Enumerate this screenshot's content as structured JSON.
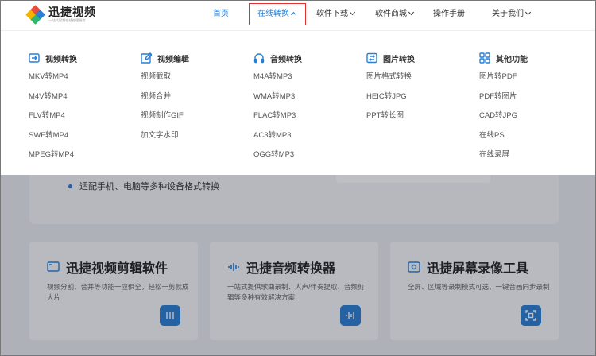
{
  "header": {
    "logo_name": "迅捷视频",
    "logo_slogan": "一站式视频在线处理服务"
  },
  "nav": [
    {
      "label": "首页"
    },
    {
      "label": "在线转换"
    },
    {
      "label": "软件下载"
    },
    {
      "label": "软件商城"
    },
    {
      "label": "操作手册"
    },
    {
      "label": "关于我们"
    }
  ],
  "dropdown": {
    "columns": [
      {
        "title": "视频转换",
        "icon": "video-convert-icon",
        "items": [
          "MKV转MP4",
          "M4V转MP4",
          "FLV转MP4",
          "SWF转MP4",
          "MPEG转MP4"
        ]
      },
      {
        "title": "视频编辑",
        "icon": "edit-icon",
        "items": [
          "视频截取",
          "视频合并",
          "视频制作GIF",
          "加文字水印"
        ]
      },
      {
        "title": "音频转换",
        "icon": "headphones-icon",
        "items": [
          "M4A转MP3",
          "WMA转MP3",
          "FLAC转MP3",
          "AC3转MP3",
          "OGG转MP3"
        ]
      },
      {
        "title": "图片转换",
        "icon": "image-convert-icon",
        "items": [
          "图片格式转换",
          "HEIC转JPG",
          "PPT转长图"
        ]
      },
      {
        "title": "其他功能",
        "icon": "grid-icon",
        "items": [
          "图片转PDF",
          "PDF转图片",
          "CAD转JPG",
          "在线PS",
          "在线录屏"
        ]
      }
    ]
  },
  "page": {
    "bullet": "适配手机、电脑等多种设备格式转换",
    "cards": [
      {
        "title": "迅捷视频剪辑软件",
        "desc": "视频分割、合并等功能一应俱全，轻松一剪就成大片",
        "icon": "video-edit-icon"
      },
      {
        "title": "迅捷音频转换器",
        "desc": "一站式提供歌曲录制、人声/伴奏提取、音频剪辑等多种有效解决方案",
        "icon": "audio-wave-icon"
      },
      {
        "title": "迅捷屏幕录像工具",
        "desc": "全屏、区域等录制模式可选，一键音画同步录制",
        "icon": "screen-record-icon"
      }
    ]
  },
  "colors": {
    "accent": "#2a7fd4",
    "highlight_box": "#e03131"
  }
}
